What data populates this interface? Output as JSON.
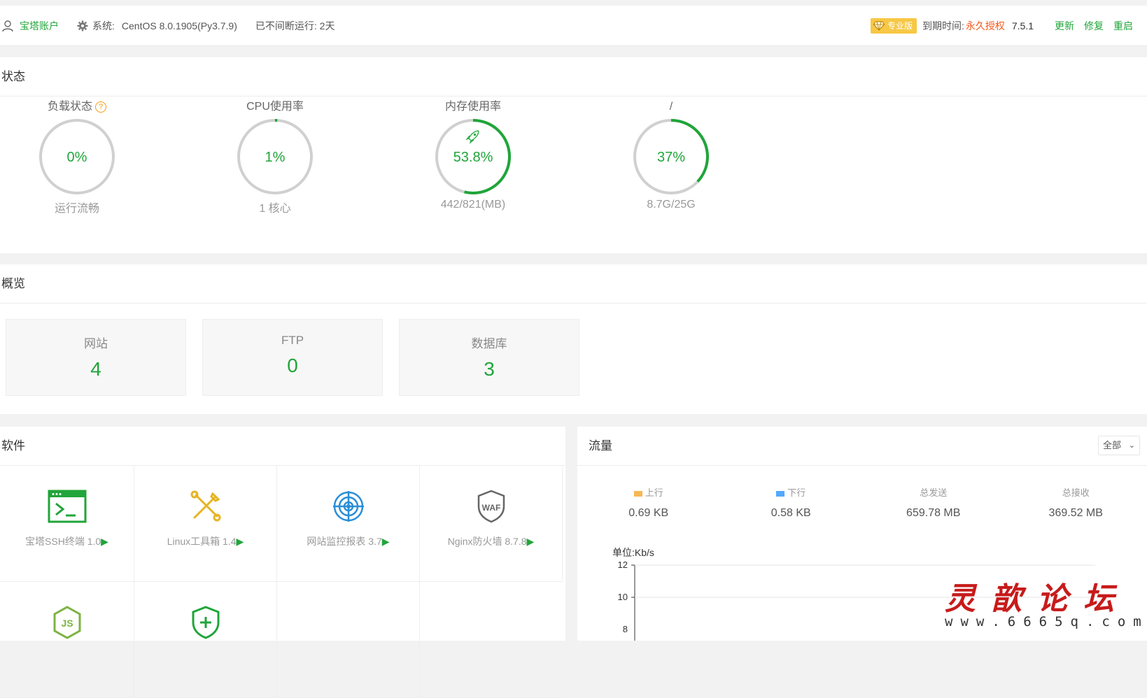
{
  "topbar": {
    "account": "宝塔账户",
    "system_label": "系统:",
    "system_value": "CentOS 8.0.1905(Py3.7.9)",
    "uptime": "已不间断运行: 2天",
    "badge": "专业版",
    "expire_label": "到期时间:",
    "expire_value": "永久授权",
    "version": "7.5.1",
    "links": {
      "update": "更新",
      "repair": "修复",
      "restart": "重启"
    }
  },
  "status": {
    "title": "状态",
    "gauges": [
      {
        "title": "负载状态",
        "value": "0%",
        "percent": 0,
        "sub": "运行流畅",
        "has_help": true
      },
      {
        "title": "CPU使用率",
        "value": "1%",
        "percent": 1,
        "sub": "1 核心"
      },
      {
        "title": "内存使用率",
        "value": "53.8%",
        "percent": 53.8,
        "sub": "442/821(MB)",
        "has_rocket": true
      },
      {
        "title": "/",
        "value": "37%",
        "percent": 37,
        "sub": "8.7G/25G"
      }
    ]
  },
  "overview": {
    "title": "概览",
    "cards": [
      {
        "label": "网站",
        "value": "4"
      },
      {
        "label": "FTP",
        "value": "0"
      },
      {
        "label": "数据库",
        "value": "3"
      }
    ]
  },
  "software": {
    "title": "软件",
    "items": [
      {
        "label": "宝塔SSH终端 1.0",
        "icon": "terminal-icon"
      },
      {
        "label": "Linux工具箱 1.4",
        "icon": "tools-icon"
      },
      {
        "label": "网站监控报表 3.7",
        "icon": "radar-icon"
      },
      {
        "label": "Nginx防火墙 8.7.8",
        "icon": "waf-icon"
      },
      {
        "label": "",
        "icon": "nodejs-icon"
      },
      {
        "label": "",
        "icon": "shield-plus-icon"
      }
    ]
  },
  "traffic": {
    "title": "流量",
    "select_value": "全部",
    "stats": [
      {
        "label": "上行",
        "value": "0.69 KB",
        "color": "#f7b851"
      },
      {
        "label": "下行",
        "value": "0.58 KB",
        "color": "#52a9ff"
      },
      {
        "label": "总发送",
        "value": "659.78 MB"
      },
      {
        "label": "总接收",
        "value": "369.52 MB"
      }
    ],
    "unit": "单位:Kb/s",
    "y_ticks": [
      "12",
      "10",
      "8"
    ]
  },
  "watermark": {
    "text": "灵歆论坛",
    "url": "www.6665q.com"
  },
  "colors": {
    "accent": "#20a53a",
    "warning": "#f7591d",
    "badge": "#f7c845"
  }
}
